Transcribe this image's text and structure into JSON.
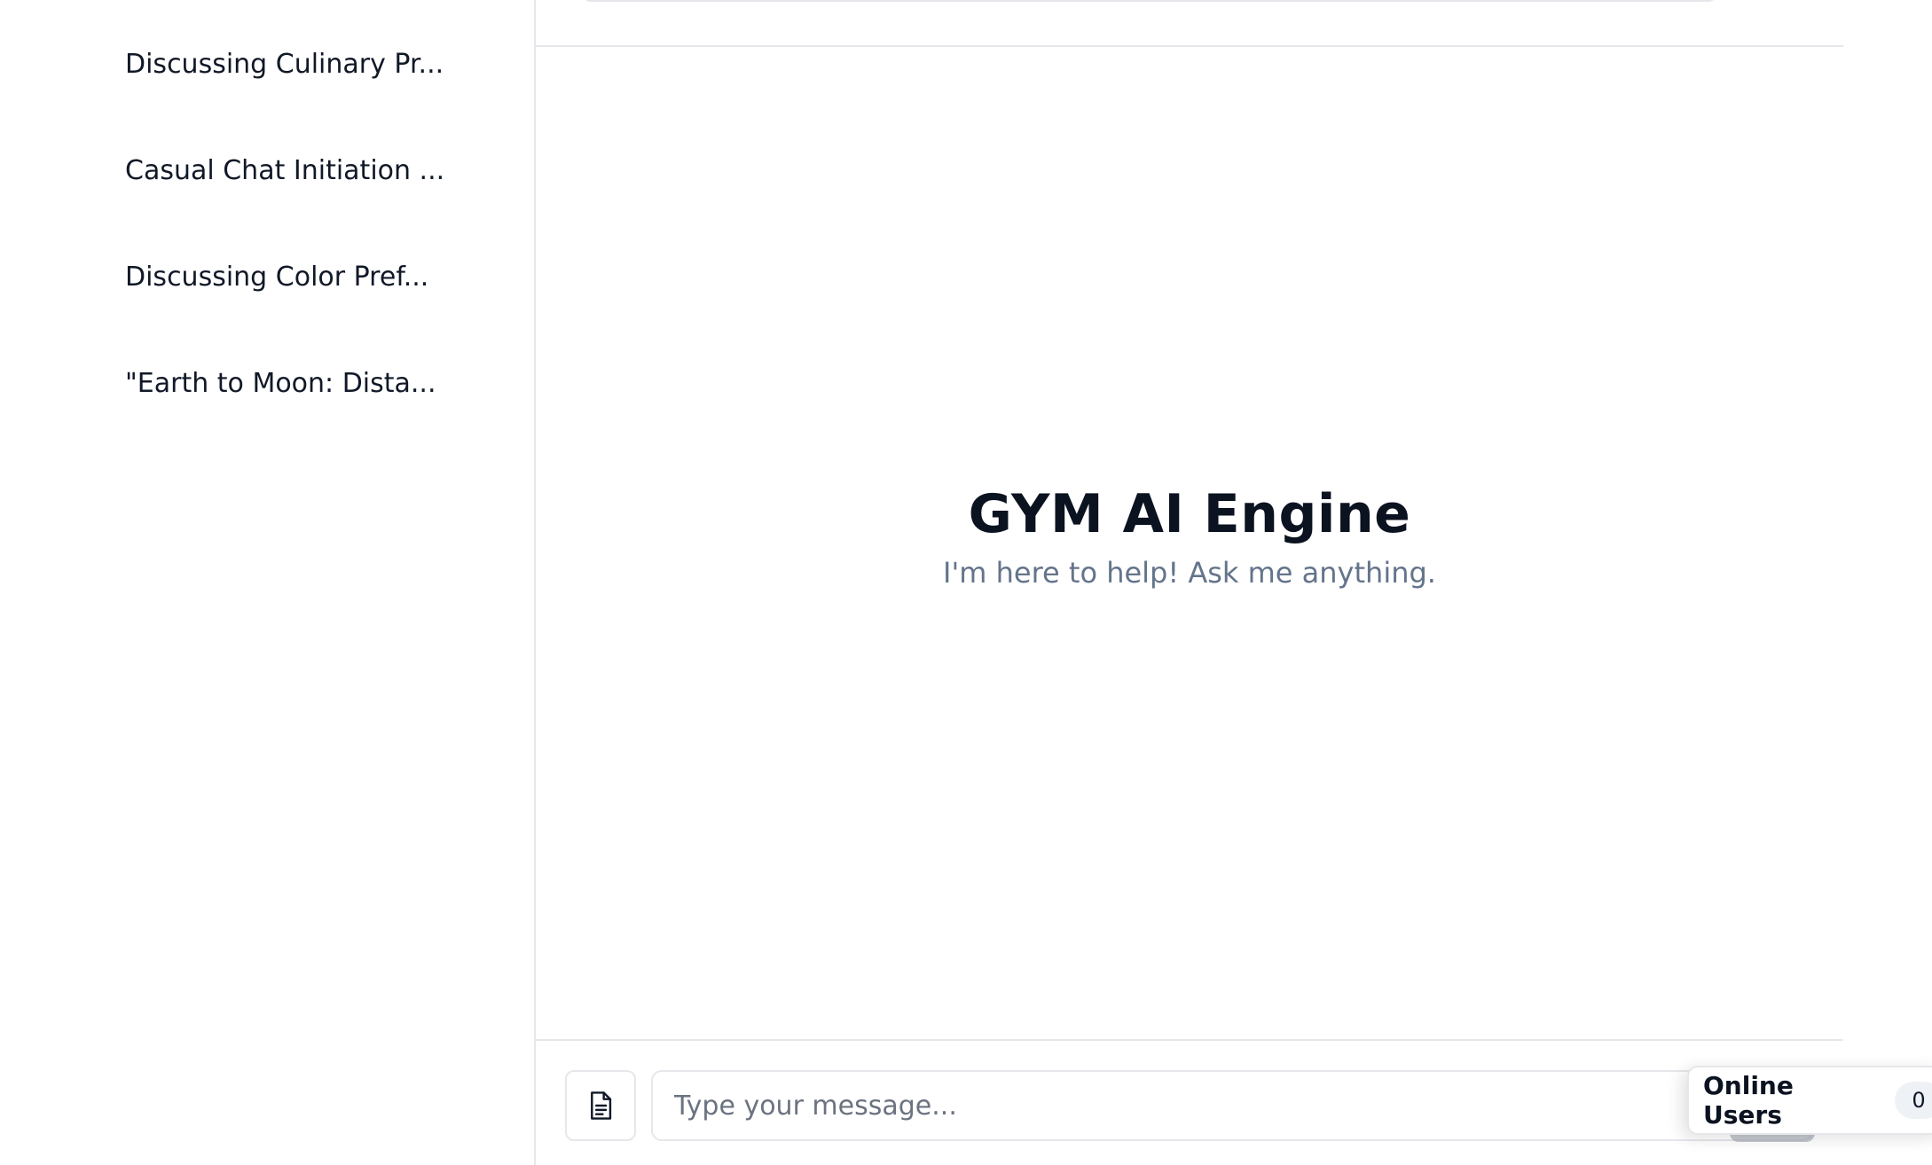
{
  "sidebar": {
    "chats": [
      {
        "label": "Discussing Culinary Pr..."
      },
      {
        "label": "Casual Chat Initiation ..."
      },
      {
        "label": "Discussing Color Pref..."
      },
      {
        "label": "\"Earth to Moon: Dista..."
      }
    ]
  },
  "main": {
    "title": "GYM AI Engine",
    "subtitle": "I'm here to help! Ask me anything."
  },
  "composer": {
    "placeholder": "Type your message...",
    "attach_icon": "document-icon"
  },
  "online_users": {
    "label": "Online Users",
    "count": "0"
  }
}
